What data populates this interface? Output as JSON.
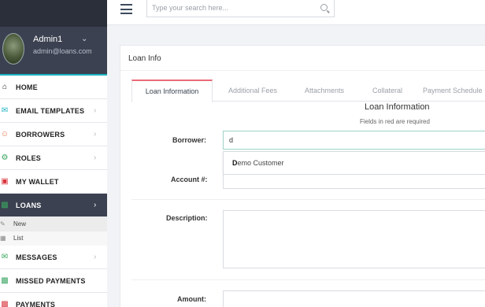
{
  "user": {
    "name": "Admin1",
    "email": "admin@loans.com"
  },
  "search": {
    "placeholder": "Type your search here..."
  },
  "nav": {
    "home": "HOME",
    "email_templates": "EMAIL TEMPLATES",
    "borrowers": "BORROWERS",
    "roles": "ROLES",
    "my_wallet": "MY WALLET",
    "loans": "LOANS",
    "loans_sub": {
      "new": "New",
      "list": "List"
    },
    "messages": "MESSAGES",
    "missed_payments": "MISSED PAYMENTS",
    "partial": "PAYMENTS"
  },
  "panel": {
    "title": "Loan Info"
  },
  "tabs": [
    "Loan Information",
    "Additional Fees",
    "Attachments",
    "Collateral",
    "Payment Schedule"
  ],
  "form": {
    "section_title": "Loan Information",
    "section_note": "Fields in red are required",
    "borrower_label": "Borrower:",
    "borrower_value": "d",
    "suggestion_match": "D",
    "suggestion_rest": "emo Customer",
    "account_label": "Account #:",
    "description_label": "Description:",
    "amount_label": "Amount:"
  },
  "colors": {
    "sidebar_dark": "#3b4150",
    "accent_teal": "#1fb2c4",
    "tab_active_border": "#e86a78"
  },
  "icons": [
    "home-icon",
    "envelope-icon",
    "smile-icon",
    "gears-icon",
    "wallet-icon",
    "money-icon",
    "edit-icon",
    "list-icon",
    "messages-icon",
    "missed-payments-icon",
    "search-icon",
    "hamburger-icon",
    "chevron-down-icon",
    "chevron-right-icon"
  ]
}
